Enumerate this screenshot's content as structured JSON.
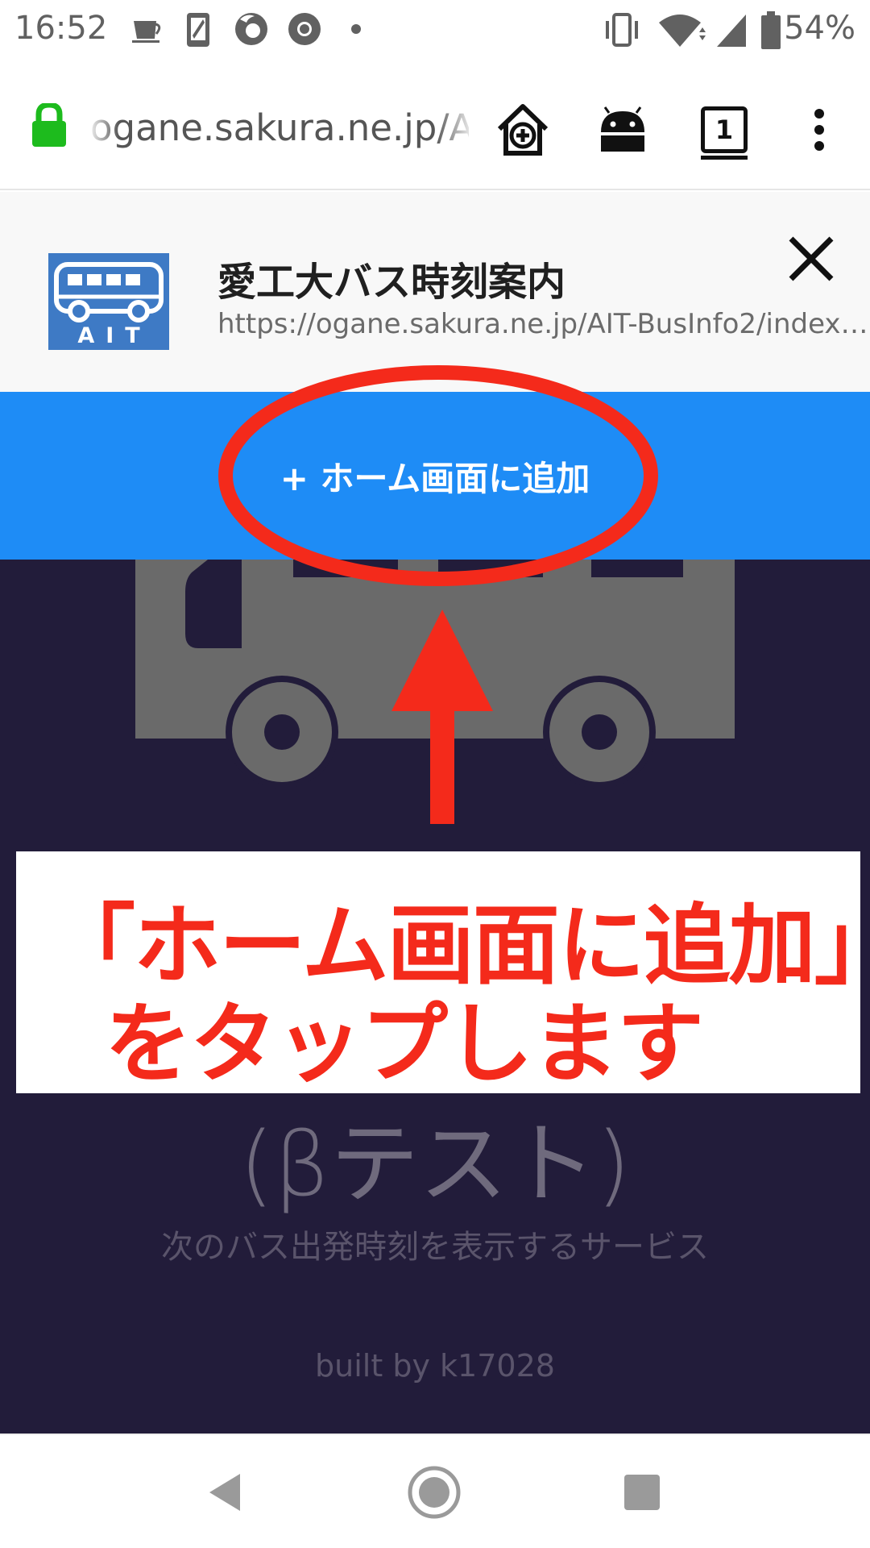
{
  "status_bar": {
    "time": "16:52",
    "battery_percent": "54%",
    "notification_icons": [
      "coffee-icon",
      "phone-screen-icon",
      "firefox-icon",
      "chrome-icon",
      "dot-icon"
    ],
    "system_icons": [
      "vibrate-icon",
      "wifi-icon",
      "signal-icon",
      "battery-icon"
    ]
  },
  "browser": {
    "url": "ogane.sakura.ne.jp/AIT-BusInfo2/",
    "tab_count": "1",
    "lock_color": "#1dbb1d"
  },
  "install_banner": {
    "app_icon_label": "AIT",
    "app_name": "愛工大バス時刻案内",
    "app_url": "https://ogane.sakura.ne.jp/AIT-BusInfo2/index.html",
    "add_button_label": "+ ホーム画面に追加",
    "accent_color": "#1e8cf6"
  },
  "page": {
    "beta_label": "(βテスト)",
    "service_description": "次のバス出発時刻を表示するサービス",
    "built_by": "built by k17028",
    "background_color": "#221c3a"
  },
  "annotation": {
    "line1": "「ホーム画面に追加」",
    "line2": "をタップします",
    "color": "#f42a1b"
  }
}
